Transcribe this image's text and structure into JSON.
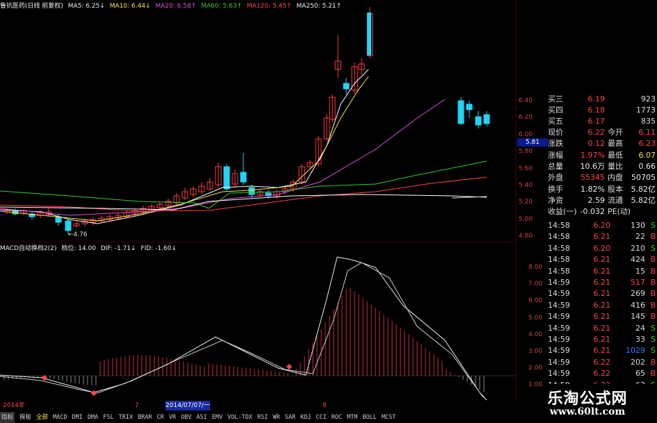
{
  "main_header": {
    "stock_label": "鲁抗医药(日线 前复权)",
    "ma5": "MA5: 6.25↓",
    "ma10": "MA10: 6.44↓",
    "ma20": "MA20: 6.58↑",
    "ma60": "MA60: 5.63↑",
    "ma120": "MA120: 5.45↑",
    "ma250": "MA250: 5.21↑"
  },
  "low_marker": "←4.76",
  "macd_header": {
    "name": "MACD自动换档2(2)",
    "level": "档位: 14.00",
    "dif": "DIF: -1.71↓",
    "fid": "FID: -1.60↓"
  },
  "price_axis": [
    "6.40",
    "6.20",
    "6.00",
    "5.80",
    "5.60",
    "5.40",
    "5.20",
    "5.00",
    "4.80"
  ],
  "price_tag": "5.81",
  "macd_axis": [
    "8.00",
    "7.00",
    "6.00",
    "5.00",
    "4.00",
    "3.00",
    "2.00",
    "1.00"
  ],
  "quotes": {
    "bid_rows": [
      {
        "label": "买三",
        "price": "6.19",
        "vol": "923"
      },
      {
        "label": "买四",
        "price": "6.18",
        "vol": "1773"
      },
      {
        "label": "买五",
        "price": "6.17",
        "vol": "835"
      }
    ],
    "rows": [
      {
        "l1": "现价",
        "v1": "6.22",
        "l2": "今开",
        "v2": "6.11"
      },
      {
        "l1": "涨跌",
        "v1": "0.12",
        "l2": "最高",
        "v2": "6.23"
      },
      {
        "l1": "涨幅",
        "v1": "1.97%",
        "l2": "最低",
        "v2": "6.07"
      },
      {
        "l1": "总量",
        "v1": "10.6万",
        "l2": "量比",
        "v2": "0.66"
      },
      {
        "l1": "外盘",
        "v1": "55345",
        "l2": "内盘",
        "v2": "50705"
      },
      {
        "l1": "换手",
        "v1": "1.82%",
        "l2": "股本",
        "v2": "5.82亿"
      },
      {
        "l1": "净资",
        "v1": "2.59",
        "l2": "流通",
        "v2": "5.82亿"
      },
      {
        "l1": "收益(一)",
        "v1": "-0.032",
        "l2": "PE(动)",
        "v2": ""
      }
    ]
  },
  "ticks": [
    {
      "t": "14:58",
      "p": "6.20",
      "q": "130",
      "s": "S"
    },
    {
      "t": "14:58",
      "p": "6.21",
      "q": "22",
      "s": "B"
    },
    {
      "t": "14:58",
      "p": "6.20",
      "q": "210",
      "s": "S"
    },
    {
      "t": "14:58",
      "p": "6.21",
      "q": "424",
      "s": "B"
    },
    {
      "t": "14:58",
      "p": "6.21",
      "q": "15",
      "s": "B"
    },
    {
      "t": "14:59",
      "p": "6.21",
      "q": "517",
      "s": "B"
    },
    {
      "t": "14:59",
      "p": "6.21",
      "q": "269",
      "s": "B"
    },
    {
      "t": "14:59",
      "p": "6.21",
      "q": "416",
      "s": "B"
    },
    {
      "t": "14:59",
      "p": "6.21",
      "q": "145",
      "s": "B"
    },
    {
      "t": "14:59",
      "p": "6.21",
      "q": "24",
      "s": "S"
    },
    {
      "t": "14:59",
      "p": "6.21",
      "q": "33",
      "s": "S"
    },
    {
      "t": "14:59",
      "p": "6.21",
      "q": "1029",
      "s": "S"
    },
    {
      "t": "14:59",
      "p": "6.22",
      "q": "202",
      "s": "B"
    },
    {
      "t": "14:59",
      "p": "6.22",
      "q": "65",
      "s": "B"
    },
    {
      "t": "14:59",
      "p": "6.22",
      "q": "63",
      "s": "S"
    }
  ],
  "dates": {
    "d1": "2014年",
    "d2": "7",
    "d3": "2014/07/07/一",
    "d4": "8"
  },
  "tabs": [
    "指标",
    "模板",
    "全部",
    "MACD",
    "DMI",
    "DMA",
    "FSL",
    "TRIX",
    "BRAR",
    "CR",
    "VR",
    "OBV",
    "ASI",
    "EMV",
    "VOL-TDX",
    "RSI",
    "WR",
    "SAR",
    "KDJ",
    "CCI",
    "ROC",
    "MTM",
    "BOLL",
    "MCST"
  ],
  "watermark": {
    "line1": "乐淘公式网",
    "line2": "www.60lt.com"
  },
  "colors": {
    "up": "#ff3b3b",
    "down": "#22d3f5",
    "ma5": "#ffffff",
    "ma10": "#ffe24a",
    "ma20": "#e050e0",
    "ma60": "#33cc33",
    "ma120": "#ff4444",
    "ma250": "#ffffff"
  }
}
